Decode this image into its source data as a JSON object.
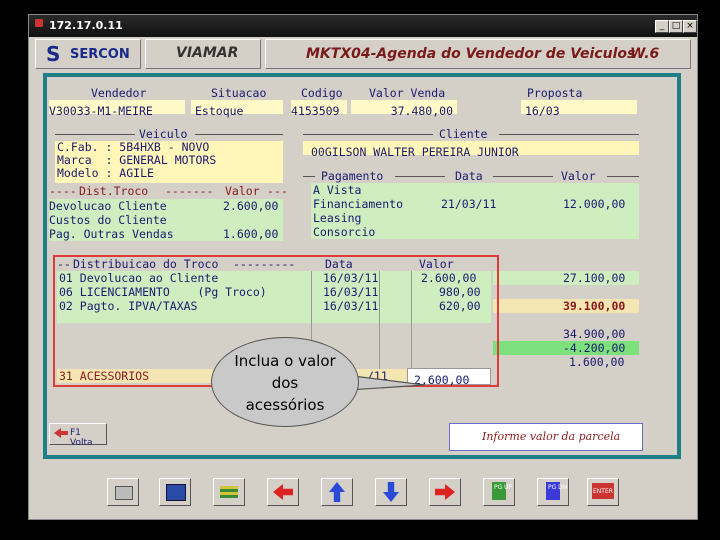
{
  "window": {
    "title": "172.17.0.11"
  },
  "header": {
    "company": "SERCON",
    "module": "VIAMAR",
    "screen_title": "MKTX04-Agenda do Vendedor de Veiculos",
    "version": "W.6"
  },
  "top": {
    "labels": [
      "Vendedor",
      "Situacao",
      "Codigo",
      "Valor Venda",
      "Proposta"
    ],
    "vendedor": "V30033-M1-MEIRE",
    "situacao": "Estoque",
    "codigo": "4153509",
    "valor_venda": "37.480,00",
    "proposta": "16/03"
  },
  "veiculo": {
    "title": "Veiculo",
    "rows": [
      "C.Fab. : 5B4HXB - NOVO",
      "Marca  : GENERAL MOTORS",
      "Modelo : AGILE"
    ]
  },
  "dist_troco": {
    "title": "Dist.Troco",
    "valor_label": "Valor",
    "rows": [
      {
        "label": "Devolucao Cliente",
        "value": "2.600,00"
      },
      {
        "label": "Custos do Cliente",
        "value": ""
      },
      {
        "label": "Pag. Outras Vendas",
        "value": "1.600,00"
      }
    ]
  },
  "cliente": {
    "title": "Cliente",
    "name": "00GILSON WALTER PEREIRA JUNIOR"
  },
  "pagamento": {
    "headers": [
      "Pagamento",
      "Data",
      "Valor"
    ],
    "rows": [
      {
        "label": "A Vista",
        "data": "",
        "valor": ""
      },
      {
        "label": "Financiamento",
        "data": "21/03/11",
        "valor": "12.000,00"
      },
      {
        "label": "Leasing",
        "data": "",
        "valor": ""
      },
      {
        "label": "Consorcio",
        "data": "",
        "valor": ""
      }
    ],
    "totals": [
      "27.100,00",
      "39.100,00",
      "34.900,00",
      "-4.200,00",
      "1.600,00"
    ]
  },
  "distribuicao": {
    "title": "Distribuicao do Troco",
    "headers": [
      "Data",
      "Valor"
    ],
    "rows": [
      {
        "desc": "01 Devolucao ao Cliente",
        "data": "16/03/11",
        "valor": "2.600,00"
      },
      {
        "desc": "06 LICENCIAMENTO    (Pg Troco)",
        "data": "16/03/11",
        "valor": "980,00"
      },
      {
        "desc": "02 Pagto. IPVA/TAXAS",
        "data": "16/03/11",
        "valor": "620,00"
      }
    ],
    "input_row": {
      "desc": "31 ACESSORIOS",
      "data": "/11",
      "valor": "2.600,00"
    }
  },
  "callout": {
    "text": "Inclua o valor dos acessórios"
  },
  "bottom": {
    "f1_label": "F1 Volta",
    "message": "Informe valor da parcela",
    "pgup": "PG UP",
    "pgdn": "PG DN",
    "enter": "ENTER"
  },
  "colors": {
    "frame": "#1f7f86",
    "highlight_border": "#e03a3a",
    "text": "#1a1a70"
  }
}
